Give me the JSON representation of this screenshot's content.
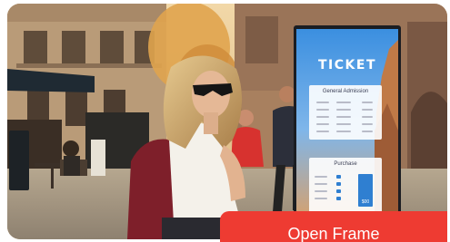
{
  "badge": {
    "label": "Open Frame",
    "color": "#ee3b32"
  },
  "kiosk": {
    "title": "TICKET",
    "general_heading": "General Admission",
    "purchase_heading": "Purchase",
    "price_label": "$00"
  },
  "colors": {
    "kiosk_blue": "#2f7fd1",
    "street_stone": "#c9b79a"
  }
}
